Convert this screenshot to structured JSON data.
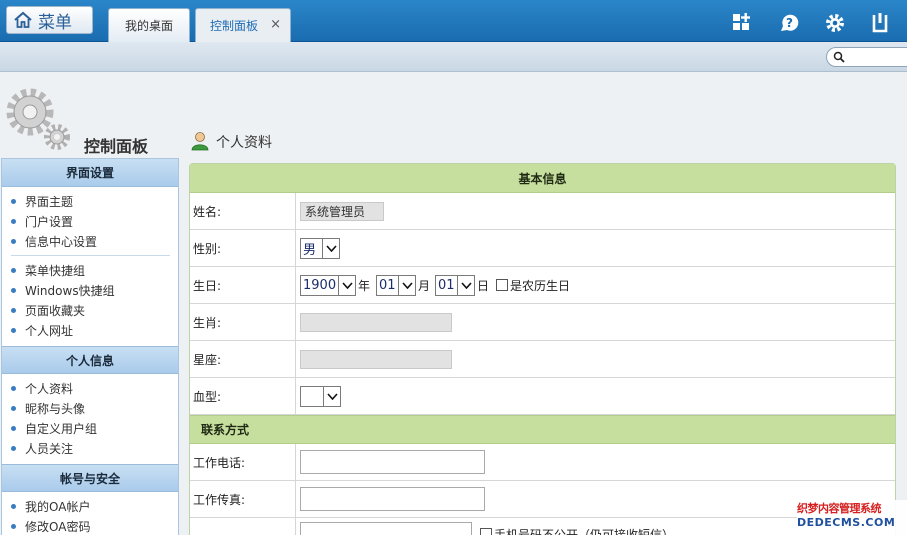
{
  "header": {
    "menu_label": "菜单",
    "tabs": [
      {
        "label": "我的桌面"
      },
      {
        "label": "控制面板",
        "close": "×"
      }
    ]
  },
  "sidebar": {
    "title": "控制面板",
    "sections": [
      {
        "title": "界面设置",
        "groups": [
          [
            "界面主题",
            "门户设置",
            "信息中心设置"
          ],
          [
            "菜单快捷组",
            "Windows快捷组",
            "页面收藏夹",
            "个人网址"
          ]
        ]
      },
      {
        "title": "个人信息",
        "groups": [
          [
            "个人资料",
            "昵称与头像",
            "自定义用户组",
            "人员关注"
          ]
        ]
      },
      {
        "title": "帐号与安全",
        "groups": [
          [
            "我的OA帐户",
            "修改OA密码"
          ]
        ]
      }
    ]
  },
  "content": {
    "title": "个人资料",
    "basic_section": "基本信息",
    "contact_section": "联系方式",
    "fields": {
      "name_label": "姓名:",
      "name_value": "系统管理员",
      "gender_label": "性别:",
      "gender_value": "男",
      "birthday_label": "生日:",
      "birth_year": "1900",
      "year_unit": "年",
      "birth_month": "01",
      "month_unit": "月",
      "birth_day": "01",
      "day_unit": "日",
      "lunar_label": "是农历生日",
      "zodiac_label": "生肖:",
      "constellation_label": "星座:",
      "blood_label": "血型:",
      "work_phone_label": "工作电话:",
      "work_fax_label": "工作传真:",
      "mobile_private_label": "手机号码不公开（仍可接收短信）"
    }
  },
  "watermark": {
    "line1": "织梦内容管理系统",
    "line2": "DEDECMS.COM"
  }
}
